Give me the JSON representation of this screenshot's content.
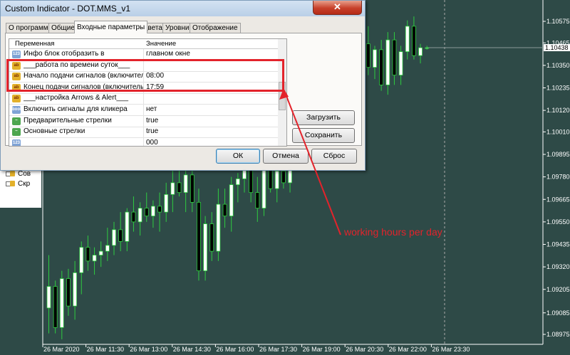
{
  "window": {
    "title": "Custom Indicator - DOT.MMS_v1",
    "close_glyph": "✕"
  },
  "tabs": [
    "О программе",
    "Общие",
    "Входные параметры",
    "Цвета",
    "Уровни",
    "Отображение"
  ],
  "active_tab": 2,
  "grid": {
    "col_variable": "Переменная",
    "col_value": "Значение",
    "rows": [
      {
        "icon": "123",
        "name": "Инфо блок отобразить в",
        "value": "главном окне"
      },
      {
        "icon": "ab",
        "name": "___работа по времени суток___",
        "value": ""
      },
      {
        "icon": "ab",
        "name": "Начало подачи сигналов (включительно)",
        "value": "08:00"
      },
      {
        "icon": "ab",
        "name": "Конец подачи сигналов (включительно)",
        "value": "17:59"
      },
      {
        "icon": "ab",
        "name": "___настройка Arrows & Alert___",
        "value": ""
      },
      {
        "icon": "bool",
        "name": "Включить сигналы для кликера",
        "value": "нет"
      },
      {
        "icon": "color",
        "name": "Предварительные стрелки",
        "value": "true"
      },
      {
        "icon": "color",
        "name": "Основные стрелки",
        "value": "true"
      },
      {
        "icon": "123",
        "name": "",
        "value": "000"
      }
    ]
  },
  "buttons": {
    "load": "Загрузить",
    "save": "Сохранить",
    "ok": "ОК",
    "cancel": "Отмена",
    "reset": "Сброс"
  },
  "left_panel": {
    "items": [
      "Сов",
      "Скр"
    ]
  },
  "annotation": "working hours per day",
  "colors": {
    "chart_bg": "#2e4a47",
    "bull": "#ffffff",
    "bear": "#000000",
    "wick": "#2ecc40",
    "annotation": "#e3232b"
  },
  "chart_data": {
    "type": "candlestick",
    "price_labels": [
      "1.10575",
      "1.10465",
      "1.10438",
      "1.10350",
      "1.10235",
      "1.10120",
      "1.10010",
      "1.09895",
      "1.09780",
      "1.09665",
      "1.09550",
      "1.09435",
      "1.09320",
      "1.09205",
      "1.09085",
      "1.08975"
    ],
    "current_price": "1.10438",
    "time_labels": [
      "26 Mar 2020",
      "26 Mar 11:30",
      "26 Mar 13:00",
      "26 Mar 14:30",
      "26 Mar 16:00",
      "26 Mar 17:30",
      "26 Mar 19:00",
      "26 Mar 20:30",
      "26 Mar 22:00",
      "26 Mar 23:30"
    ],
    "candles": [
      [
        1.0911,
        1.0938,
        1.0898,
        1.0922
      ],
      [
        1.0922,
        1.0925,
        1.0898,
        1.0901
      ],
      [
        1.0901,
        1.093,
        1.0895,
        1.0926
      ],
      [
        1.0926,
        1.0931,
        1.0907,
        1.0912
      ],
      [
        1.0912,
        1.0935,
        1.0905,
        1.0929
      ],
      [
        1.0929,
        1.0945,
        1.0918,
        1.0942
      ],
      [
        1.0942,
        1.0948,
        1.093,
        1.0935
      ],
      [
        1.0935,
        1.0942,
        1.0928,
        1.0938
      ],
      [
        1.0938,
        1.0945,
        1.0932,
        1.094
      ],
      [
        1.094,
        1.0952,
        1.0935,
        1.0943
      ],
      [
        1.0943,
        1.0955,
        1.0938,
        1.0951
      ],
      [
        1.0951,
        1.096,
        1.094,
        1.0945
      ],
      [
        1.0945,
        1.0962,
        1.094,
        1.096
      ],
      [
        1.096,
        1.0968,
        1.095,
        1.0955
      ],
      [
        1.0955,
        1.0965,
        1.0948,
        1.0962
      ],
      [
        1.0962,
        1.097,
        1.0955,
        1.0958
      ],
      [
        1.0958,
        1.0966,
        1.0952,
        1.0963
      ],
      [
        1.0963,
        1.097,
        1.095,
        1.096
      ],
      [
        1.096,
        1.0975,
        1.0955,
        1.0969
      ],
      [
        1.0969,
        1.0982,
        1.096,
        1.0975
      ],
      [
        1.0975,
        1.0986,
        1.0968,
        1.097
      ],
      [
        1.097,
        1.0982,
        1.096,
        1.0979
      ],
      [
        1.0979,
        1.0985,
        1.096,
        1.0965
      ],
      [
        1.0965,
        1.0972,
        1.0925,
        1.093
      ],
      [
        1.093,
        1.0958,
        1.0925,
        1.0954
      ],
      [
        1.0954,
        1.096,
        1.0935,
        1.094
      ],
      [
        1.094,
        1.0972,
        1.0935,
        1.0964
      ],
      [
        1.0964,
        1.0972,
        1.0952,
        1.0958
      ],
      [
        1.0958,
        1.0978,
        1.095,
        1.0974
      ],
      [
        1.0974,
        1.098,
        1.0965,
        1.0977
      ],
      [
        1.0977,
        1.0995,
        1.097,
        1.0988
      ],
      [
        1.0988,
        1.0992,
        1.0965,
        1.097
      ],
      [
        1.097,
        1.0978,
        1.0955,
        1.0962
      ],
      [
        1.0962,
        1.099,
        1.0958,
        1.0984
      ],
      [
        1.0984,
        1.0992,
        1.097,
        1.0972
      ],
      [
        1.0972,
        1.0985,
        1.0965,
        1.0981
      ],
      [
        1.0981,
        1.099,
        1.0972,
        1.0975
      ],
      [
        1.0975,
        1.1008,
        1.097,
        1.1002
      ],
      [
        1.1002,
        1.102,
        1.0995,
        1.1015
      ],
      [
        1.1015,
        1.1025,
        1.1005,
        1.101
      ],
      [
        1.101,
        1.103,
        1.1005,
        1.1026
      ],
      [
        1.1026,
        1.1035,
        1.1015,
        1.102
      ],
      [
        1.102,
        1.1038,
        1.1015,
        1.1032
      ],
      [
        1.1032,
        1.104,
        1.1022,
        1.1028
      ],
      [
        1.1028,
        1.1045,
        1.1022,
        1.104
      ],
      [
        1.104,
        1.105,
        1.1032,
        1.1036
      ],
      [
        1.1036,
        1.1045,
        1.103,
        1.1042
      ],
      [
        1.1042,
        1.1048,
        1.1032,
        1.1035
      ],
      [
        1.1035,
        1.105,
        1.103,
        1.1046
      ],
      [
        1.1046,
        1.1055,
        1.103,
        1.1034
      ],
      [
        1.1034,
        1.1045,
        1.1028,
        1.1043
      ],
      [
        1.1043,
        1.1048,
        1.1022,
        1.1025
      ],
      [
        1.1025,
        1.1052,
        1.102,
        1.1048
      ],
      [
        1.1048,
        1.1052,
        1.1025,
        1.103
      ],
      [
        1.103,
        1.1045,
        1.1025,
        1.1042
      ],
      [
        1.1042,
        1.1058,
        1.1038,
        1.1055
      ],
      [
        1.1055,
        1.106,
        1.1038,
        1.104
      ],
      [
        1.104,
        1.1046,
        1.1036,
        1.1044
      ],
      [
        1.1044,
        1.1045,
        1.1043,
        1.1044
      ]
    ]
  }
}
